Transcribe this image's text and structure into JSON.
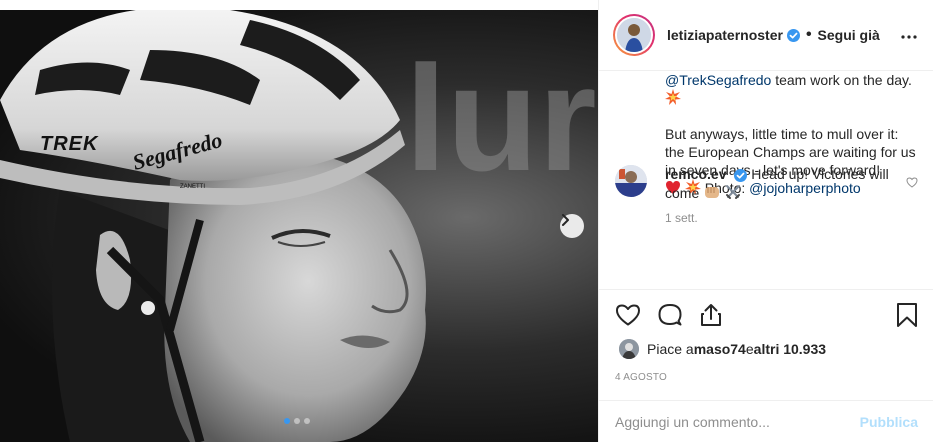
{
  "photo": {
    "helmet_brand": "TREK",
    "helmet_sponsor": "Segafredo",
    "helmet_sub": "ZANETTI",
    "slide_count": 3,
    "active_slide": 1
  },
  "post": {
    "username": "letiziapaternoster",
    "separator": "•",
    "follow_label": "Segui già",
    "caption": {
      "line1_mention": "@TrekSegafredo",
      "line1_rest": " team work on the day.",
      "para2": "But anyways, little time to mull over it: the European Champs are waiting for us in seven days - let's move forward!",
      "photo_label": " Photo: ",
      "photo_mention": "@jojoharperphoto"
    },
    "caption_time": "1 sett.",
    "comment": {
      "user": "remco.ev",
      "text": "Head up! Victories will come"
    },
    "likes": {
      "prefix": "Piace a ",
      "user": "maso74",
      "middle": " e ",
      "others": "altri 10.933"
    },
    "date": "4 agosto",
    "add_comment": {
      "placeholder": "Aggiungi un commento...",
      "publish_label": "Pubblica"
    }
  },
  "icons": [
    "chevron-right-icon",
    "verified-icon",
    "more-icon",
    "heart-icon",
    "comment-icon",
    "share-icon",
    "bookmark-icon",
    "collision-emoji",
    "red-heart-emoji",
    "crossed-swords-emoji",
    "fist-emoji"
  ],
  "colors": {
    "mention": "#00376b",
    "verified": "#3897f0",
    "publish_disabled": "#b2dffc",
    "muted": "#8e8e8e"
  }
}
